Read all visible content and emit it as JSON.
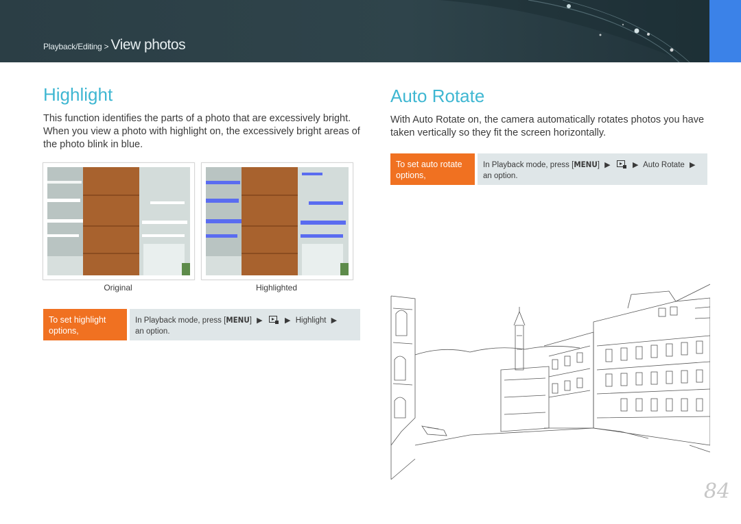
{
  "header": {
    "breadcrumb_parent": "Playback/Editing",
    "breadcrumb_sep": ">",
    "breadcrumb_current": "View photos"
  },
  "highlight": {
    "title": "Highlight",
    "description": "This function identifies the parts of a photo that are excessively bright. When you view a photo with highlight on, the excessively bright areas of the photo blink in blue.",
    "caption_original": "Original",
    "caption_highlighted": "Highlighted",
    "tag_label": "To set highlight options,",
    "instr_prefix": "In Playback mode, press [",
    "instr_menu": "MENU",
    "instr_suffix": "]",
    "instr_item": "Highlight",
    "instr_end": "an option."
  },
  "auto_rotate": {
    "title": "Auto Rotate",
    "description": "With Auto Rotate on, the camera automatically rotates photos you have taken vertically so they fit the screen horizontally.",
    "tag_label": "To set auto rotate options,",
    "instr_prefix": "In Playback mode, press [",
    "instr_menu": "MENU",
    "instr_suffix": "]",
    "instr_item": "Auto Rotate",
    "instr_end": "an option."
  },
  "page_number": "84",
  "colors": {
    "accent_heading": "#3fb7d2",
    "tag_orange": "#f07121",
    "instr_bg": "#dfe6e8",
    "header_bg": "#2f444b",
    "header_accent": "#3b82e8",
    "highlight_blue": "#5a6cf0"
  }
}
